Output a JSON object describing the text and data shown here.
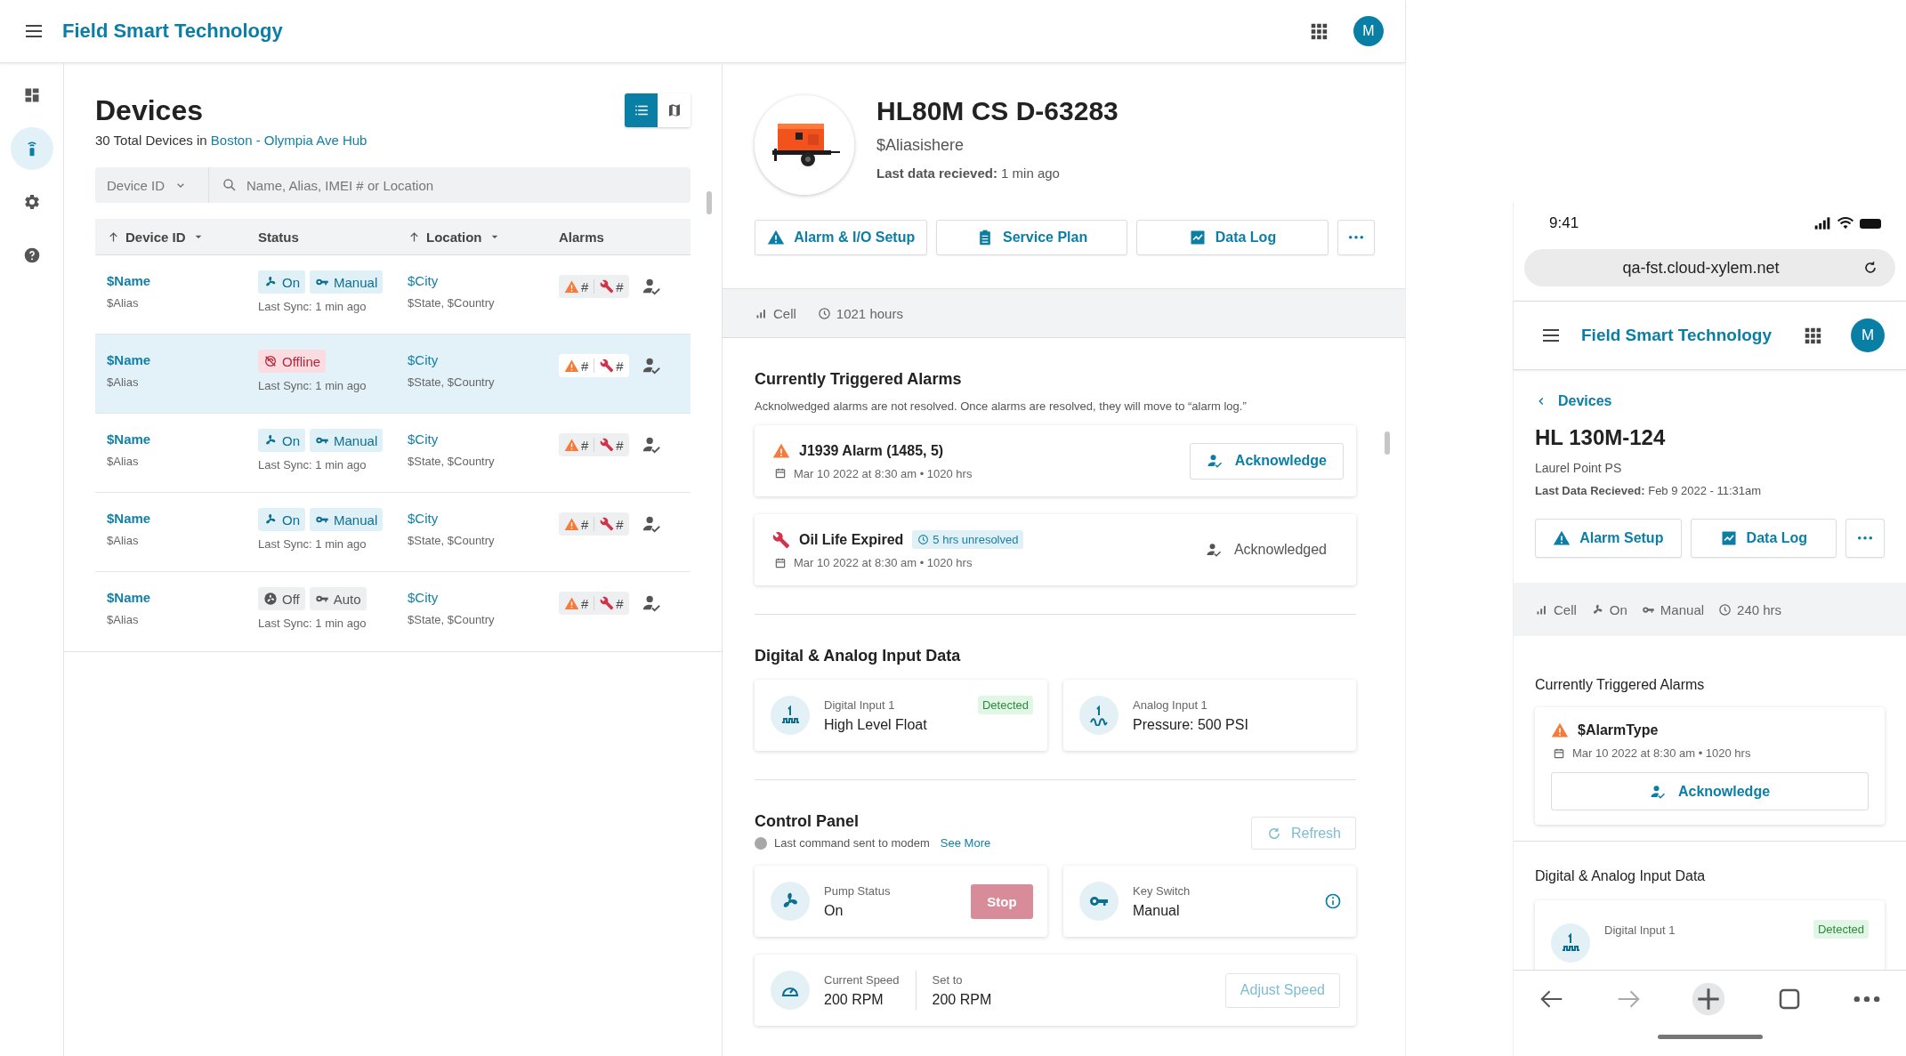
{
  "app": {
    "title": "Field Smart Technology",
    "avatar": "M"
  },
  "rail": [
    {
      "kind": "dashboard",
      "selected": false
    },
    {
      "kind": "devices",
      "selected": true
    },
    {
      "kind": "settings",
      "selected": false
    },
    {
      "kind": "help",
      "selected": false
    }
  ],
  "devices": {
    "title": "Devices",
    "count_text": "30 Total Devices in",
    "location_link": "Boston - Olympia Ave Hub",
    "views": [
      {
        "kind": "list",
        "selected": true
      },
      {
        "kind": "map",
        "selected": false
      }
    ],
    "filter": {
      "value": "Device ID"
    },
    "search": {
      "placeholder": "Name, Alias, IMEI # or Location"
    },
    "columns": [
      {
        "label": "Device ID",
        "sortable": true
      },
      {
        "label": "Status",
        "sortable": false
      },
      {
        "label": "Location",
        "sortable": true
      },
      {
        "label": "Alarms",
        "sortable": false
      }
    ],
    "rows": [
      {
        "name": "$Name",
        "alias": "$Alias",
        "status": {
          "kind": "on",
          "label": "On"
        },
        "mode": "Manual",
        "last_sync": "Last Sync: 1 min ago",
        "city": "$City",
        "region": "$State, $Country",
        "alarm_count": "#",
        "service_count": "#",
        "selected": false
      },
      {
        "name": "$Name",
        "alias": "$Alias",
        "status": {
          "kind": "offline",
          "label": "Offline"
        },
        "last_sync": "Last Sync: 1 min ago",
        "city": "$City",
        "region": "$State, $Country",
        "alarm_count": "#",
        "service_count": "#",
        "selected": true
      },
      {
        "name": "$Name",
        "alias": "$Alias",
        "status": {
          "kind": "on",
          "label": "On"
        },
        "mode": "Manual",
        "last_sync": "Last Sync: 1 min ago",
        "city": "$City",
        "region": "$State, $Country",
        "alarm_count": "#",
        "service_count": "#",
        "selected": false
      },
      {
        "name": "$Name",
        "alias": "$Alias",
        "status": {
          "kind": "on",
          "label": "On"
        },
        "mode": "Manual",
        "last_sync": "Last Sync: 1 min ago",
        "city": "$City",
        "region": "$State, $Country",
        "alarm_count": "#",
        "service_count": "#",
        "selected": false
      },
      {
        "name": "$Name",
        "alias": "$Alias",
        "status": {
          "kind": "off",
          "label": "Off"
        },
        "mode": "Auto",
        "last_sync": "Last Sync: 1 min ago",
        "city": "$City",
        "region": "$State, $Country",
        "alarm_count": "#",
        "service_count": "#",
        "selected": false
      }
    ]
  },
  "detail": {
    "title": "HL80M CS D-63283",
    "alias": "$Aliasishere",
    "last_label": "Last data recieved:",
    "last_value": "1 min ago",
    "actions": [
      {
        "kind": "warning",
        "label": "Alarm & I/O Setup"
      },
      {
        "kind": "clipboard",
        "label": "Service Plan"
      },
      {
        "kind": "chart",
        "label": "Data Log"
      },
      {
        "kind": "more"
      }
    ],
    "info": [
      {
        "kind": "signal",
        "label": "Cell"
      },
      {
        "kind": "clock",
        "label": "1021 hours"
      }
    ],
    "alarms": {
      "title": "Currently Triggered Alarms",
      "description": "Acknolwedged alarms are not resolved. Once alarms are resolved, they will move to “alarm log.”",
      "items": [
        {
          "kind": "warning",
          "title": "J1939 Alarm (1485, 5)",
          "date": "Mar 10 2022 at 8:30 am • 1020 hrs",
          "acknowledged": false,
          "action": "Acknowledge"
        },
        {
          "kind": "service",
          "title": "Oil Life Expired",
          "badge": "5 hrs unresolved",
          "date": "Mar 10 2022 at 8:30 am • 1020 hrs",
          "acknowledged": true,
          "action": "Acknowledged"
        }
      ]
    },
    "inputs": {
      "title": "Digital & Analog Input Data",
      "items": [
        {
          "kind": "digital",
          "label": "Digital Input 1",
          "value": "High Level Float",
          "badge": "Detected"
        },
        {
          "kind": "analog",
          "label": "Analog Input 1",
          "value": "Pressure: 500 PSI"
        }
      ]
    },
    "control": {
      "title": "Control Panel",
      "status_text": "Last command sent to modem",
      "link": "See More",
      "refresh": "Refresh",
      "pump": {
        "label": "Pump Status",
        "value": "On",
        "button": "Stop"
      },
      "key": {
        "label": "Key Switch",
        "value": "Manual"
      },
      "speed": {
        "current_label": "Current Speed",
        "current_value": "200 RPM",
        "set_label": "Set to",
        "set_value": "200 RPM",
        "button": "Adjust Speed"
      }
    }
  },
  "phone": {
    "time": "9:41",
    "url": "qa-fst.cloud-xylem.net",
    "app_title": "Field Smart Technology",
    "avatar": "M",
    "back": "Devices",
    "title": "HL 130M-124",
    "subtitle": "Laurel Point PS",
    "last_label": "Last Data Recieved:",
    "last_value": "Feb 9 2022 - 11:31am",
    "actions": [
      {
        "kind": "warning",
        "label": "Alarm Setup"
      },
      {
        "kind": "chart",
        "label": "Data Log"
      },
      {
        "kind": "more"
      }
    ],
    "info": [
      {
        "kind": "signal",
        "label": "Cell"
      },
      {
        "kind": "fan",
        "label": "On"
      },
      {
        "kind": "key",
        "label": "Manual"
      },
      {
        "kind": "clock",
        "label": "240 hrs"
      }
    ],
    "alarms_title": "Currently Triggered Alarms",
    "alarm": {
      "kind": "warning",
      "title": "$AlarmType",
      "date": "Mar 10 2022 at 8:30 am • 1020 hrs",
      "action": "Acknowledge"
    },
    "inputs_title": "Digital & Analog Input Data",
    "input": {
      "kind": "digital",
      "label": "Digital Input 1",
      "badge": "Detected"
    }
  }
}
